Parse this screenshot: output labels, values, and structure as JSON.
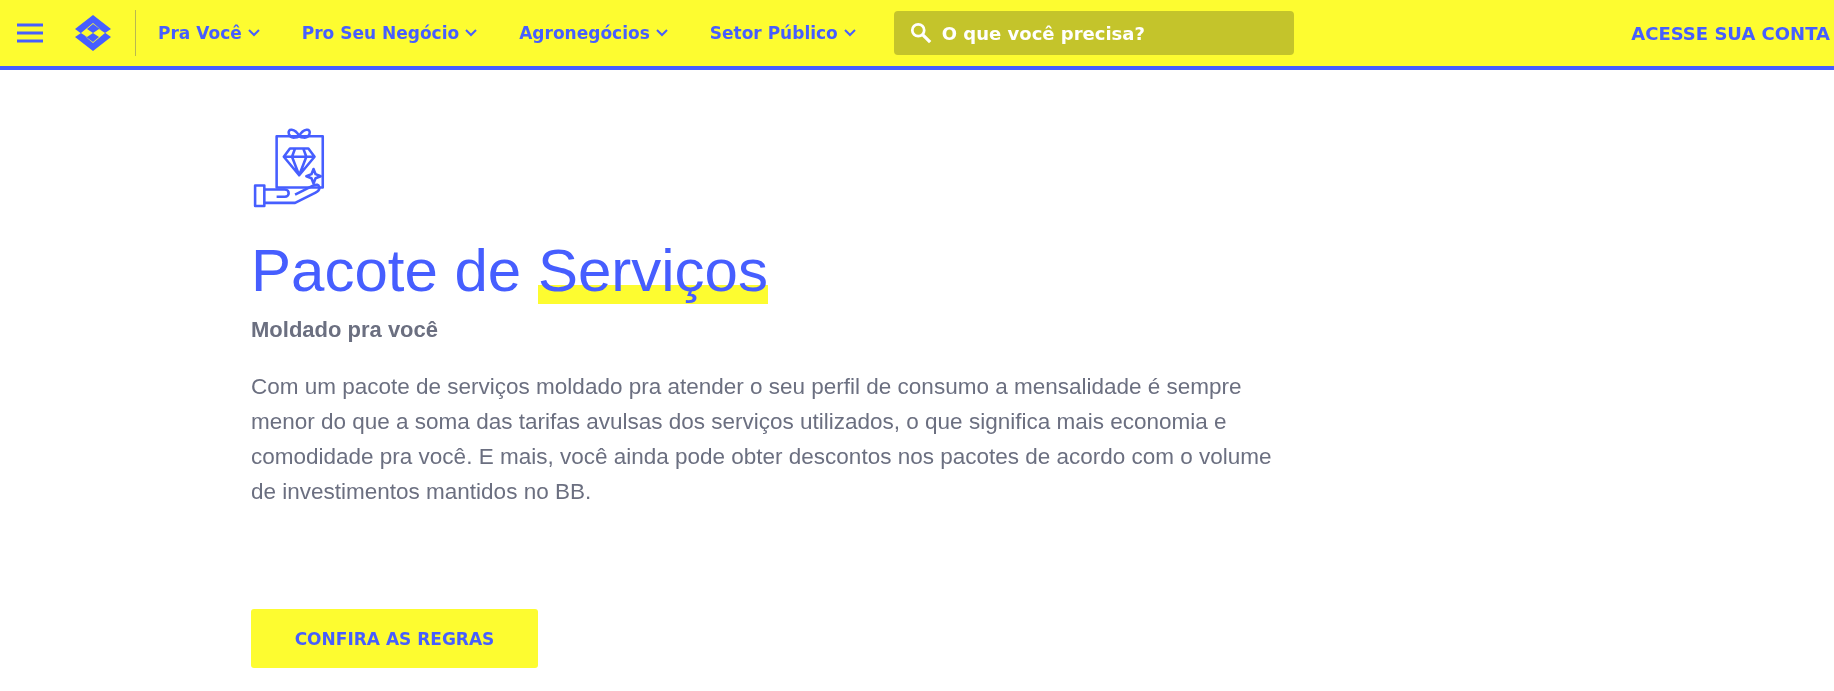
{
  "header": {
    "nav": [
      {
        "label": "Pra Você",
        "has_dropdown": true
      },
      {
        "label": "Pro Seu Negócio",
        "has_dropdown": true
      },
      {
        "label": "Agronegócios",
        "has_dropdown": true
      },
      {
        "label": "Setor Público",
        "has_dropdown": true
      }
    ],
    "search": {
      "placeholder": "O que você precisa?"
    },
    "account_link": "ACESSE SUA CONTA"
  },
  "hero": {
    "title": [
      {
        "text": "Pacote de ",
        "highlighted": false
      },
      {
        "text": "Serviços",
        "highlighted": true
      }
    ],
    "subtitle": "Moldado pra você",
    "description": "Com um pacote de serviços moldado pra atender o seu perfil de consumo  a mensalidade é sempre menor do que a soma das tarifas avulsas dos serviços utilizados, o que significa mais economia e comodidade pra você. E mais, você ainda pode obter descontos nos pacotes de acordo com o volume de investimentos mantidos no BB.",
    "button": "CONFIRA AS REGRAS"
  }
}
